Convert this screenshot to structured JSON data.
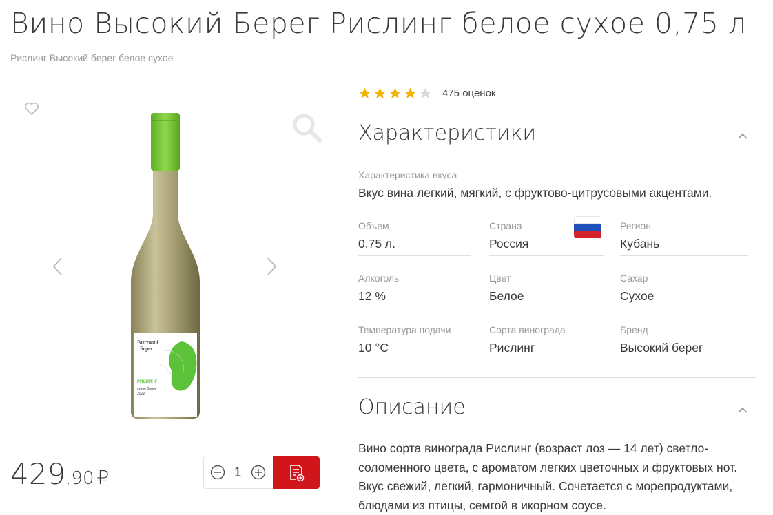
{
  "product": {
    "title": "Вино Высокий Берег Рислинг белое сухое 0,75 л",
    "subtitle": "Рислинг Высокий берег белое сухое"
  },
  "gallery": {
    "icons": [
      "heart-icon",
      "magnifier-icon",
      "chevron-left-icon",
      "chevron-right-icon"
    ],
    "label": {
      "brand_line1": "Высокий",
      "brand_line2": "Берег",
      "variety": "РИСЛИНГ",
      "type": "сухое белое",
      "year": "2022"
    }
  },
  "purchase": {
    "price_int": "429",
    "price_frac": ".90",
    "currency": "₽",
    "quantity": "1",
    "icons": [
      "minus-circle-icon",
      "plus-circle-icon",
      "add-to-list-icon"
    ]
  },
  "rating": {
    "stars": 4,
    "max": 5,
    "count_text": "475 оценок"
  },
  "characteristics": {
    "title": "Характеристики",
    "taste_label": "Характеристика вкуса",
    "taste_value": "Вкус вина легкий, мягкий, с фруктово-цитрусовыми акцентами.",
    "fields": [
      {
        "label": "Объем",
        "value": "0.75 л."
      },
      {
        "label": "Страна",
        "value": "Россия"
      },
      {
        "label": "Регион",
        "value": "Кубань"
      },
      {
        "label": "Алкоголь",
        "value": "12 %"
      },
      {
        "label": "Цвет",
        "value": "Белое"
      },
      {
        "label": "Сахар",
        "value": "Сухое"
      },
      {
        "label": "Температура подачи",
        "value": "10 °C"
      },
      {
        "label": "Сорта винограда",
        "value": "Рислинг"
      },
      {
        "label": "Бренд",
        "value": "Высокий берег"
      }
    ]
  },
  "description": {
    "title": "Описание",
    "text": "Вино сорта винограда Рислинг (возраст лоз — 14 лет) светло-соломенного цвета, с ароматом легких цветочных и фруктовых нот. Вкус свежий, легкий, гармоничный. Сочетается с морепродуктами, блюдами из птицы, семгой в икорном соусе."
  },
  "colors": {
    "accent_red": "#d0151b",
    "star_gold": "#f0b400",
    "star_empty": "#d9d9d9",
    "text_muted": "#9a9a9a",
    "capsule_green": "#7cc63a"
  }
}
